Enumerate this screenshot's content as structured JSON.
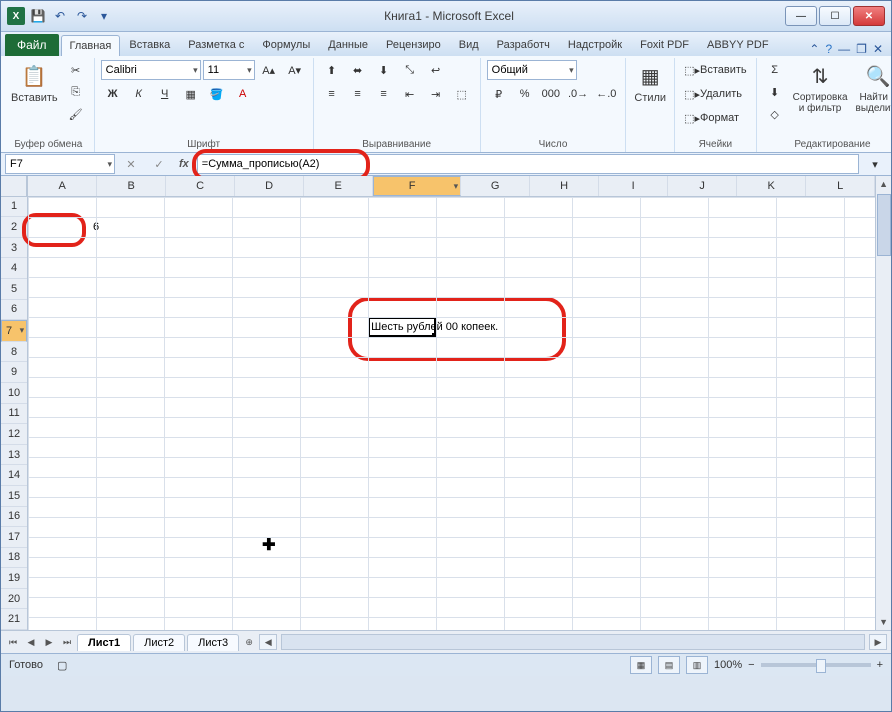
{
  "title": "Книга1 - Microsoft Excel",
  "tabs": {
    "file": "Файл",
    "items": [
      "Главная",
      "Вставка",
      "Разметка с",
      "Формулы",
      "Данные",
      "Рецензиро",
      "Вид",
      "Разработч",
      "Надстройк",
      "Foxit PDF",
      "ABBYY PDF"
    ],
    "active_index": 0
  },
  "ribbon": {
    "clipboard": {
      "paste": "Вставить",
      "label": "Буфер обмена"
    },
    "font": {
      "name": "Calibri",
      "size": "11",
      "label": "Шрифт"
    },
    "align": {
      "label": "Выравнивание"
    },
    "number": {
      "format": "Общий",
      "label": "Число"
    },
    "styles": {
      "btn": "Стили"
    },
    "cells": {
      "insert": "Вставить",
      "delete": "Удалить",
      "format": "Формат",
      "label": "Ячейки"
    },
    "editing": {
      "sort": "Сортировка и фильтр",
      "find": "Найти и выделить",
      "label": "Редактирование"
    }
  },
  "namebox": "F7",
  "formula": "=Сумма_прописью(A2)",
  "columns": [
    "A",
    "B",
    "C",
    "D",
    "E",
    "F",
    "G",
    "H",
    "I",
    "J",
    "K",
    "L"
  ],
  "sel_col_index": 5,
  "rows": 21,
  "sel_row": 7,
  "cell_A2": "6",
  "cell_F7": "Шесть рублей 00 копеек.",
  "sheets": [
    "Лист1",
    "Лист2",
    "Лист3"
  ],
  "active_sheet": 0,
  "status": "Готово",
  "zoom": "100%"
}
